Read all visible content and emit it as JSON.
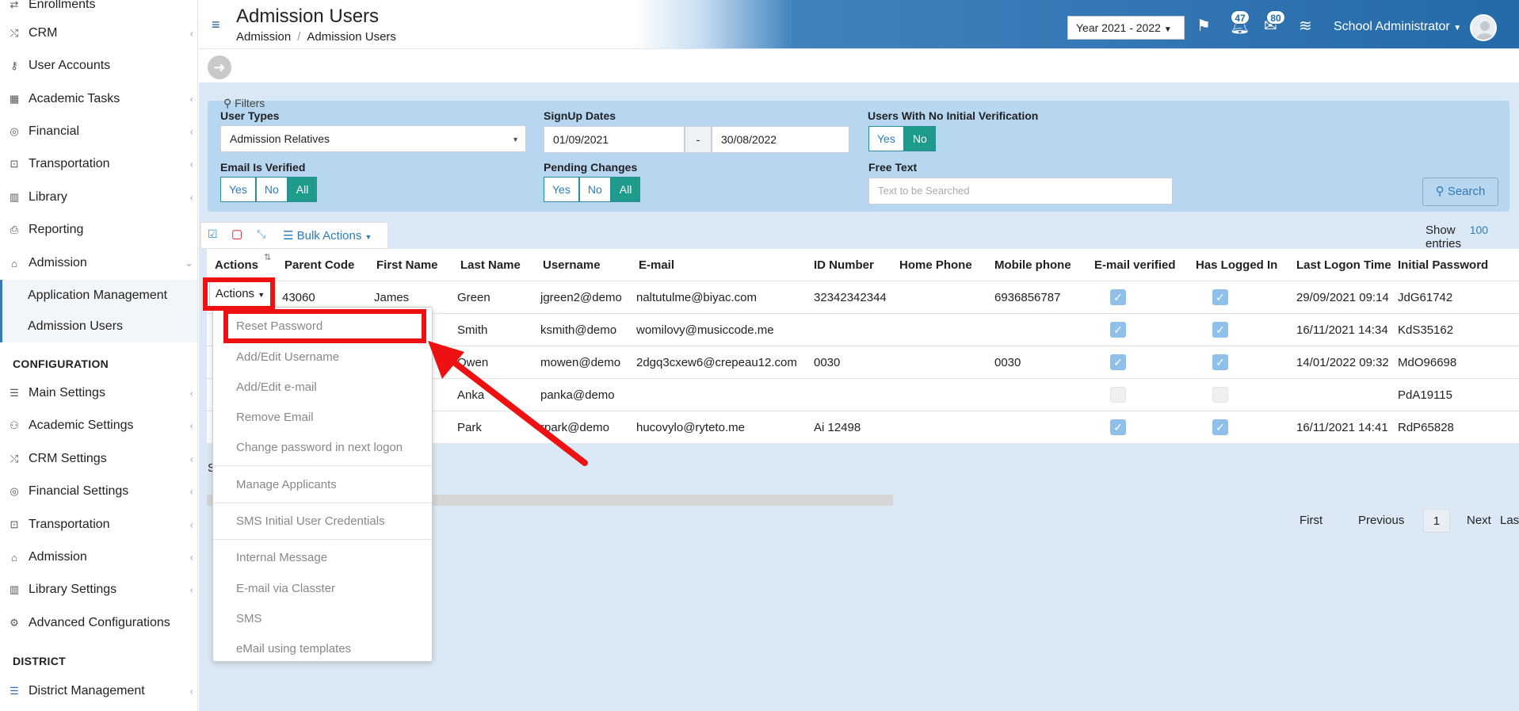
{
  "sidebar": {
    "top_partial": "Enrollments",
    "items": [
      {
        "label": "CRM",
        "icon": "shuffle-icon",
        "chevron": true
      },
      {
        "label": "User Accounts",
        "icon": "key-icon",
        "chevron": false
      },
      {
        "label": "Academic Tasks",
        "icon": "grid-icon",
        "chevron": true
      },
      {
        "label": "Financial",
        "icon": "coins-icon",
        "chevron": true
      },
      {
        "label": "Transportation",
        "icon": "bus-icon",
        "chevron": true
      },
      {
        "label": "Library",
        "icon": "books-icon",
        "chevron": true
      },
      {
        "label": "Reporting",
        "icon": "printer-icon",
        "chevron": false
      },
      {
        "label": "Admission",
        "icon": "bank-icon",
        "chevron": true
      }
    ],
    "admission_sub": [
      "Application Management",
      "Admission Users"
    ],
    "config_heading": "CONFIGURATION",
    "config_items": [
      {
        "label": "Main Settings",
        "icon": "sliders-icon"
      },
      {
        "label": "Academic Settings",
        "icon": "users-icon"
      },
      {
        "label": "CRM Settings",
        "icon": "shuffle-icon"
      },
      {
        "label": "Financial Settings",
        "icon": "coins-icon"
      },
      {
        "label": "Transportation",
        "icon": "bus-icon"
      },
      {
        "label": "Admission",
        "icon": "bank-icon"
      },
      {
        "label": "Library Settings",
        "icon": "books-icon"
      },
      {
        "label": "Advanced Configurations",
        "icon": "gears-icon"
      }
    ],
    "district_heading": "DISTRICT",
    "district_items": [
      {
        "label": "District Management",
        "icon": "list-icon"
      }
    ]
  },
  "header": {
    "title": "Admission Users",
    "breadcrumb": [
      "Admission",
      "Admission Users"
    ],
    "year": "Year 2021 - 2022",
    "badges": {
      "notifications": "47",
      "messages": "80"
    },
    "user": "School Administrator"
  },
  "filters": {
    "label": "Filters",
    "user_types_label": "User Types",
    "user_types_value": "Admission Relatives",
    "signup_label": "SignUp Dates",
    "signup_from": "01/09/2021",
    "signup_sep": "-",
    "signup_to": "30/08/2022",
    "no_init_label": "Users With No Initial Verification",
    "email_verified_label": "Email Is Verified",
    "pending_label": "Pending Changes",
    "free_text_label": "Free Text",
    "free_text_placeholder": "Text to be Searched",
    "yes": "Yes",
    "no": "No",
    "all": "All",
    "search": "Search"
  },
  "toolbar": {
    "bulk_actions": "Bulk Actions",
    "show": "Show",
    "entries_count": "100",
    "entries": "entries"
  },
  "table": {
    "columns": [
      "Actions",
      "Parent Code",
      "First Name",
      "Last Name",
      "Username",
      "E-mail",
      "ID Number",
      "Home Phone",
      "Mobile phone",
      "E-mail verified",
      "Has Logged In",
      "Last Logon Time",
      "Initial Password"
    ],
    "rows": [
      {
        "parent_code": "43060",
        "first": "James",
        "last": "Green",
        "username": "jgreen2@demo",
        "email": "naltutulme@biyac.com",
        "id_number": "32342342344",
        "home": "",
        "mobile": "6936856787",
        "email_verified": true,
        "logged_in": true,
        "last_logon": "29/09/2021 09:14",
        "password": "JdG61742"
      },
      {
        "parent_code": "",
        "first": "",
        "last": "Smith",
        "username": "ksmith@demo",
        "email": "womilovy@musiccode.me",
        "id_number": "",
        "home": "",
        "mobile": "",
        "email_verified": true,
        "logged_in": true,
        "last_logon": "16/11/2021 14:34",
        "password": "KdS35162"
      },
      {
        "parent_code": "",
        "first": "",
        "last": "Owen",
        "username": "mowen@demo",
        "email": "2dgq3cxew6@crepeau12.com",
        "id_number": "0030",
        "home": "",
        "mobile": "0030",
        "email_verified": true,
        "logged_in": true,
        "last_logon": "14/01/2022 09:32",
        "password": "MdO96698"
      },
      {
        "parent_code": "",
        "first": "",
        "last": "Anka",
        "username": "panka@demo",
        "email": "",
        "id_number": "",
        "home": "",
        "mobile": "",
        "email_verified": false,
        "logged_in": false,
        "last_logon": "",
        "password": "PdA19115"
      },
      {
        "parent_code": "",
        "first": "",
        "last": "Park",
        "username": "rpark@demo",
        "email": "hucovylo@ryteto.me",
        "id_number": "Ai 12498",
        "home": "",
        "mobile": "",
        "email_verified": true,
        "logged_in": true,
        "last_logon": "16/11/2021 14:41",
        "password": "RdP65828"
      }
    ],
    "left_partial": "S"
  },
  "pager": {
    "first": "First",
    "previous": "Previous",
    "page": "1",
    "next": "Next",
    "last": "Last"
  },
  "actions_menu": {
    "button": "Actions",
    "items": [
      "Reset Password",
      "Add/Edit Username",
      "Add/Edit e-mail",
      "Remove Email",
      "Change password in next logon",
      "Manage Applicants",
      "SMS Initial User Credentials",
      "Internal Message",
      "E-mail via Classter",
      "SMS",
      "eMail using templates"
    ]
  },
  "colors": {
    "brand": "#246aa8",
    "filter_bg": "#b7d6f0",
    "active_toggle": "#1e9b8a",
    "annotation": "#ee1111"
  }
}
